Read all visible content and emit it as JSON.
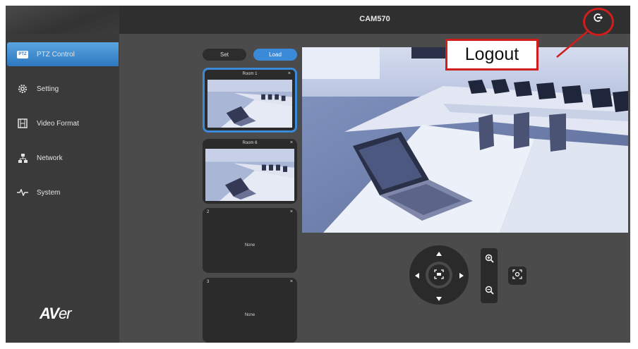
{
  "header": {
    "title": "CAM570",
    "logout_icon": "logout-icon"
  },
  "annotation": {
    "callout_text": "Logout",
    "color": "#d21d1d"
  },
  "sidebar": {
    "items": [
      {
        "label": "PTZ Control",
        "icon": "ptz-icon",
        "active": true
      },
      {
        "label": "Setting",
        "icon": "gear-icon",
        "active": false
      },
      {
        "label": "Video Format",
        "icon": "film-icon",
        "active": false
      },
      {
        "label": "Network",
        "icon": "network-icon",
        "active": false
      },
      {
        "label": "System",
        "icon": "pulse-icon",
        "active": false
      }
    ],
    "logo": {
      "brand_a": "AV",
      "brand_b": "er"
    }
  },
  "presets": {
    "set_label": "Set",
    "load_label": "Load",
    "items": [
      {
        "number": "",
        "name": "Room 1",
        "thumbnail": true,
        "selected": true
      },
      {
        "number": "",
        "name": "Room 6",
        "thumbnail": true,
        "selected": false
      },
      {
        "number": "2",
        "name": "",
        "empty_label": "None",
        "thumbnail": false,
        "selected": false
      },
      {
        "number": "3",
        "name": "",
        "empty_label": "None",
        "thumbnail": false,
        "selected": false
      }
    ]
  },
  "controls": {
    "up_icon": "arrow-up-icon",
    "down_icon": "arrow-down-icon",
    "left_icon": "arrow-left-icon",
    "right_icon": "arrow-right-icon",
    "home_icon": "home-center-icon",
    "zoom_in_icon": "zoom-in-icon",
    "zoom_out_icon": "zoom-out-icon",
    "focus_icon": "focus-icon"
  },
  "colors": {
    "accent": "#3b8ad9",
    "sidebar": "#3a3a3a",
    "panel": "#4b4b4b"
  }
}
